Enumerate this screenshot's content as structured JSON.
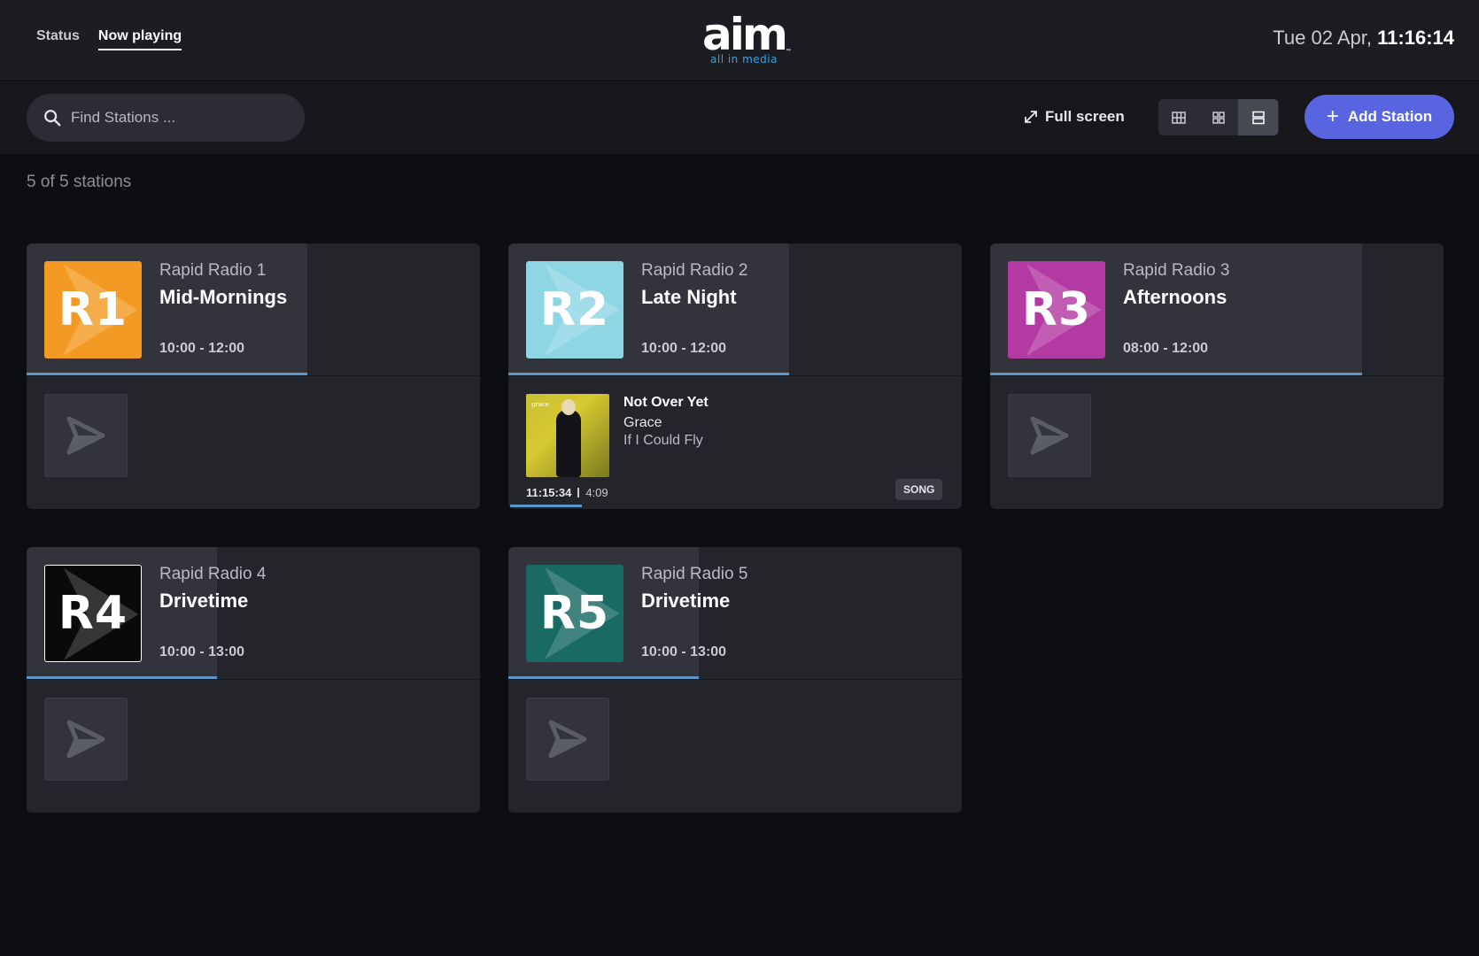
{
  "nav": {
    "items": [
      {
        "label": "Status",
        "active": false
      },
      {
        "label": "Now playing",
        "active": true
      }
    ]
  },
  "logo": {
    "word": "aim",
    "tagline": "all in media",
    "tm": "™"
  },
  "clock": {
    "date": "Tue 02 Apr,",
    "time": "11:16:14"
  },
  "toolbar": {
    "search_placeholder": "Find Stations ...",
    "fullscreen_label": "Full screen",
    "view_modes": [
      "table",
      "grid",
      "list"
    ],
    "active_view": "list",
    "add_label": "Add Station"
  },
  "count_text": "5 of 5 stations",
  "colors": {
    "accent": "#5965e0",
    "progress": "#5a97c6",
    "r1": "#f39a24",
    "r2": "#8fd6e4",
    "r3": "#b43aa3",
    "r4": "#0a0a0a",
    "r5": "#186a63"
  },
  "stations": [
    {
      "logo_text": "R1",
      "name": "Rapid Radio 1",
      "show": "Mid-Mornings",
      "time": "10:00 - 12:00",
      "progress": 0.62
    },
    {
      "logo_text": "R2",
      "name": "Rapid Radio 2",
      "show": "Late Night",
      "time": "10:00 - 12:00",
      "progress": 0.62,
      "now_playing": {
        "title": "Not Over Yet",
        "artist": "Grace",
        "album": "If I Could Fly",
        "art_label": "grace",
        "start": "11:15:34",
        "duration": "4:09",
        "type": "SONG",
        "progress": 0.16
      }
    },
    {
      "logo_text": "R3",
      "name": "Rapid Radio 3",
      "show": "Afternoons",
      "time": "08:00 - 12:00",
      "progress": 0.82
    },
    {
      "logo_text": "R4",
      "name": "Rapid Radio 4",
      "show": "Drivetime",
      "time": "10:00 - 13:00",
      "progress": 0.41
    },
    {
      "logo_text": "R5",
      "name": "Rapid Radio 5",
      "show": "Drivetime",
      "time": "10:00 - 13:00",
      "progress": 0.41
    }
  ]
}
